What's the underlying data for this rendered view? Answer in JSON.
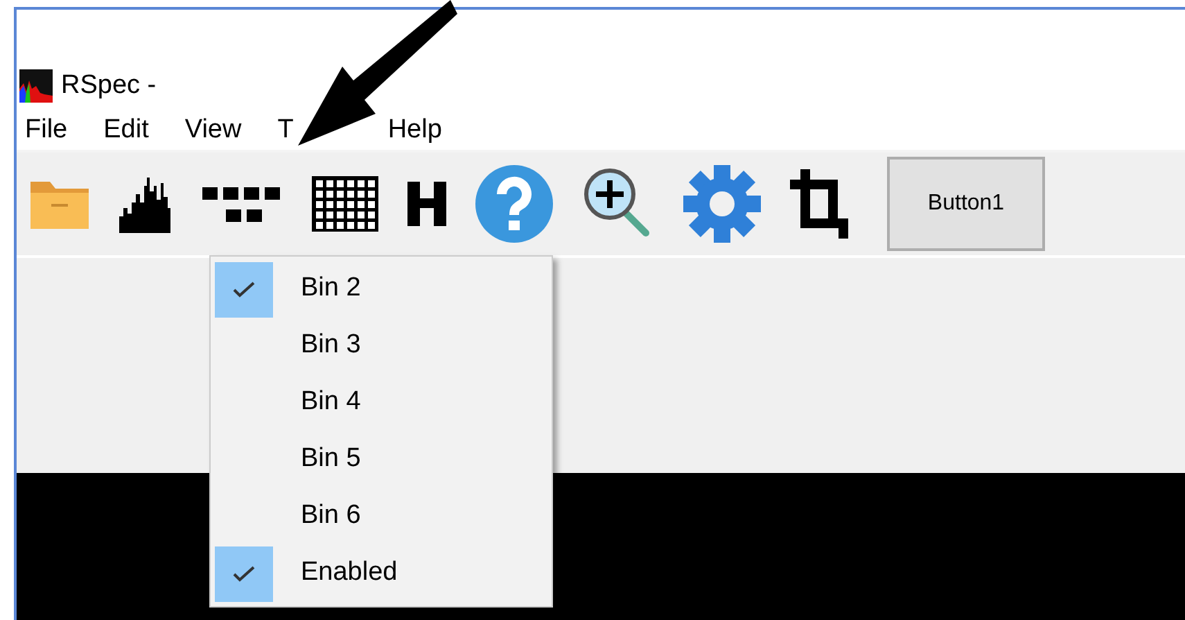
{
  "window": {
    "title": "RSpec -"
  },
  "menu_bar": [
    "File",
    "Edit",
    "View",
    "T",
    "Help"
  ],
  "toolbar": {
    "button": "Button1"
  },
  "dropdown": [
    {
      "label": "Bin 2",
      "checked": true
    },
    {
      "label": "Bin 3",
      "checked": false
    },
    {
      "label": "Bin 4",
      "checked": false
    },
    {
      "label": "Bin 5",
      "checked": false
    },
    {
      "label": "Bin 6",
      "checked": false
    },
    {
      "label": "Enabled",
      "checked": true
    }
  ]
}
